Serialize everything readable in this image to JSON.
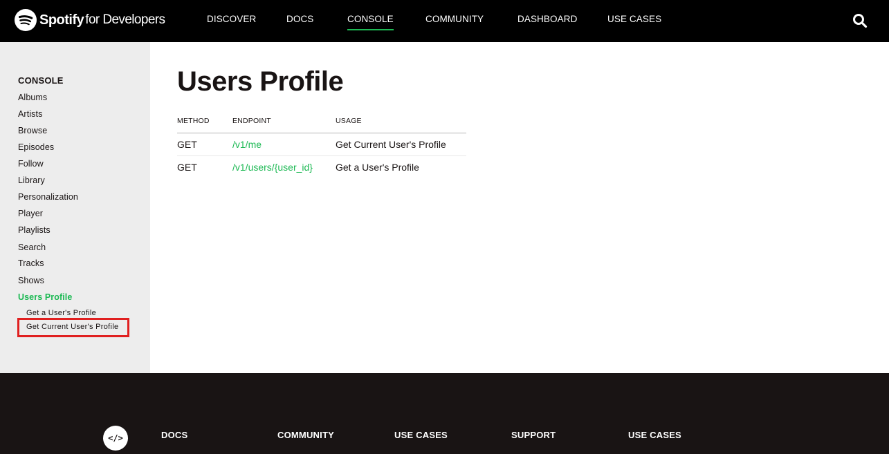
{
  "header": {
    "brand_name": "Spotify",
    "brand_suffix": "for Developers",
    "nav": [
      {
        "label": "DISCOVER",
        "active": false
      },
      {
        "label": "DOCS",
        "active": false
      },
      {
        "label": "CONSOLE",
        "active": true
      },
      {
        "label": "COMMUNITY",
        "active": false
      },
      {
        "label": "DASHBOARD",
        "active": false
      },
      {
        "label": "USE CASES",
        "active": false
      }
    ],
    "search_icon": "search-icon"
  },
  "sidebar": {
    "heading": "CONSOLE",
    "items": [
      {
        "label": "Albums"
      },
      {
        "label": "Artists"
      },
      {
        "label": "Browse"
      },
      {
        "label": "Episodes"
      },
      {
        "label": "Follow"
      },
      {
        "label": "Library"
      },
      {
        "label": "Personalization"
      },
      {
        "label": "Player"
      },
      {
        "label": "Playlists"
      },
      {
        "label": "Search"
      },
      {
        "label": "Tracks"
      },
      {
        "label": "Shows"
      },
      {
        "label": "Users Profile",
        "active": true
      }
    ],
    "subitems": [
      {
        "label": "Get a User's Profile"
      },
      {
        "label": "Get Current User's Profile",
        "highlighted": true
      }
    ]
  },
  "main": {
    "title": "Users Profile",
    "table": {
      "headers": [
        "METHOD",
        "ENDPOINT",
        "USAGE"
      ],
      "rows": [
        {
          "method": "GET",
          "endpoint": "/v1/me",
          "usage": "Get Current User's Profile"
        },
        {
          "method": "GET",
          "endpoint": "/v1/users/{user_id}",
          "usage": "Get a User's Profile"
        }
      ]
    }
  },
  "footer": {
    "badge_text": "</>",
    "columns": [
      "DOCS",
      "COMMUNITY",
      "USE CASES",
      "SUPPORT",
      "USE CASES"
    ]
  },
  "colors": {
    "brand_green": "#1db954",
    "nav_background": "#000000",
    "sidebar_background": "#ededed",
    "footer_background": "#191414",
    "highlight_border": "#e02020"
  }
}
